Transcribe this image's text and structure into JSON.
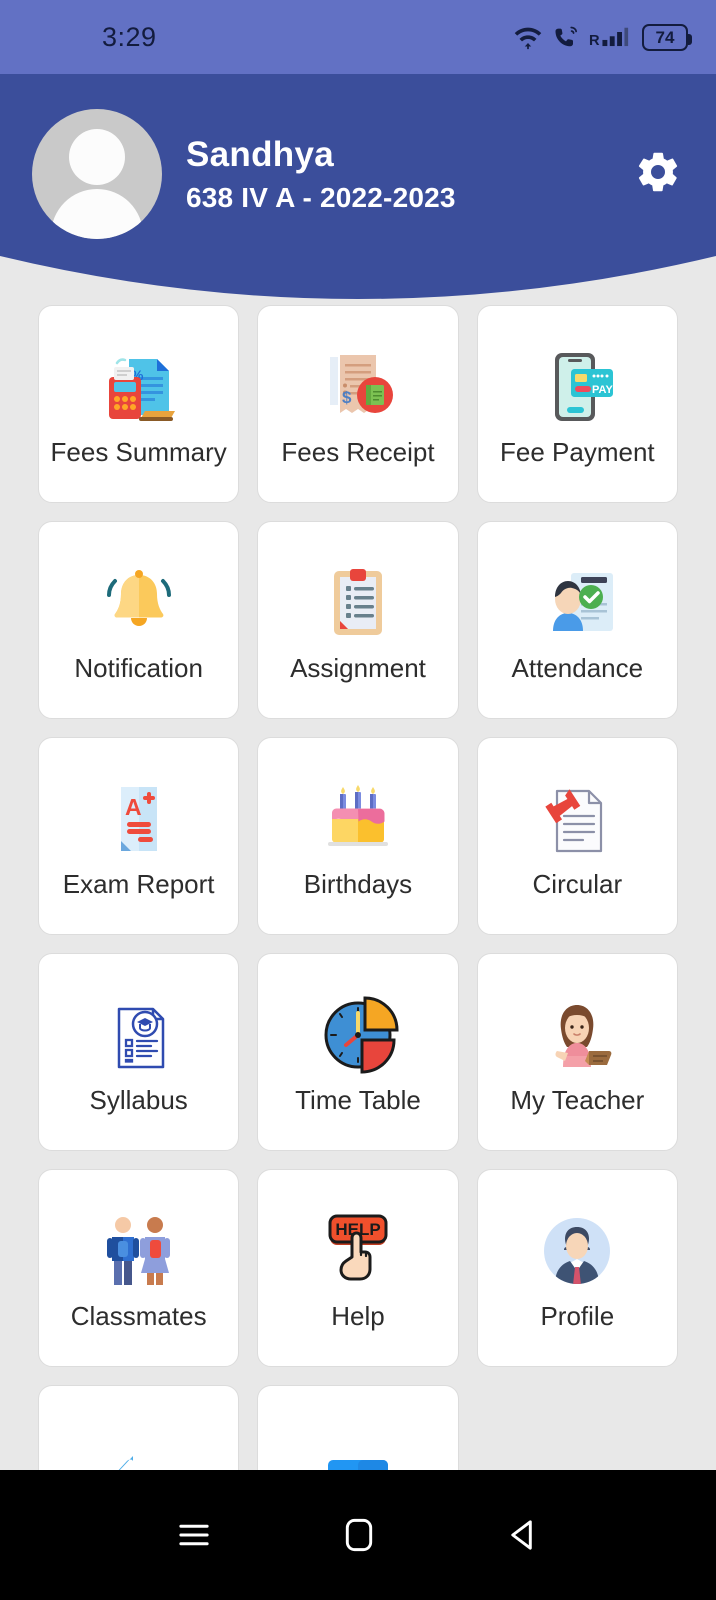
{
  "status_bar": {
    "time": "3:29",
    "battery_level": "74",
    "icons": [
      "wifi-icon",
      "vowifi-call-icon",
      "roaming-signal-icon",
      "battery-icon"
    ]
  },
  "header": {
    "student_name": "Sandhya",
    "student_class": "638 IV A - 2022-2023",
    "avatar_icon": "default-avatar-icon",
    "settings_icon": "gear-icon",
    "background_color": "#3B4E9B"
  },
  "theme": {
    "status_bar_color": "#6271C4",
    "header_color": "#3B4E9B",
    "page_background": "#E8E8E8",
    "tile_background": "#FFFFFF",
    "label_color": "#2D2D2D"
  },
  "menu": {
    "tiles": [
      {
        "label": "Fees Summary",
        "icon": "fees-summary-icon"
      },
      {
        "label": "Fees Receipt",
        "icon": "fees-receipt-icon"
      },
      {
        "label": "Fee Payment",
        "icon": "fee-payment-icon"
      },
      {
        "label": "Notification",
        "icon": "bell-icon"
      },
      {
        "label": "Assignment",
        "icon": "clipboard-icon"
      },
      {
        "label": "Attendance",
        "icon": "attendance-icon"
      },
      {
        "label": "Exam Report",
        "icon": "exam-report-icon"
      },
      {
        "label": "Birthdays",
        "icon": "birthday-cake-icon"
      },
      {
        "label": "Circular",
        "icon": "pinned-document-icon"
      },
      {
        "label": "Syllabus",
        "icon": "syllabus-icon"
      },
      {
        "label": "Time Table",
        "icon": "clock-pie-icon"
      },
      {
        "label": "My Teacher",
        "icon": "teacher-icon"
      },
      {
        "label": "Classmates",
        "icon": "classmates-icon"
      },
      {
        "label": "Help",
        "icon": "help-button-icon"
      },
      {
        "label": "Profile",
        "icon": "profile-avatar-icon"
      },
      {
        "label": "",
        "icon": "back-arrow-icon"
      },
      {
        "label": "",
        "icon": "exit-sign-icon"
      }
    ]
  },
  "nav_bar": {
    "recents_icon": "recents-menu-icon",
    "home_icon": "home-square-icon",
    "back_icon": "back-triangle-icon"
  }
}
